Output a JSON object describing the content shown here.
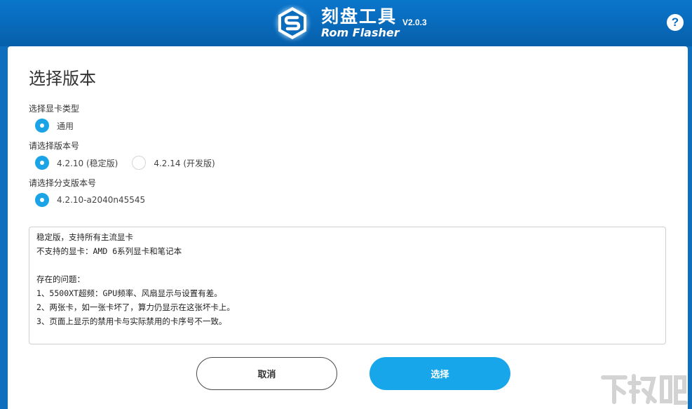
{
  "header": {
    "app_name_cn": "刻盘工具",
    "app_name_en": "Rom Flasher",
    "version": "V2.0.3",
    "help_glyph": "?",
    "brand_color": "#0a6cbd"
  },
  "page": {
    "title": "选择版本"
  },
  "gpu_type": {
    "label": "选择显卡类型",
    "options": [
      {
        "text": "通用",
        "selected": true
      }
    ]
  },
  "version_select": {
    "label": "请选择版本号",
    "options": [
      {
        "text": "4.2.10 (稳定版)",
        "selected": true
      },
      {
        "text": "4.2.14 (开发版)",
        "selected": false
      }
    ]
  },
  "branch_select": {
    "label": "请选择分支版本号",
    "options": [
      {
        "text": "4.2.10-a2040n45545",
        "selected": true
      }
    ]
  },
  "description": {
    "lines": [
      "稳定版，支持所有主流显卡",
      "不支持的显卡：AMD 6系列显卡和笔记本",
      "",
      "存在的问题：",
      "1、5500XT超频：GPU频率、风扇显示与设置有差。",
      "2、两张卡，如一张卡坏了，算力仍显示在这张坏卡上。",
      "3、页面上显示的禁用卡与实际禁用的卡序号不一致。"
    ]
  },
  "buttons": {
    "cancel_label": "取消",
    "select_label": "选择",
    "accent_color": "#17a6ea"
  },
  "icons": {
    "logo": "rom-flasher-logo-icon",
    "help": "help-icon",
    "watermark": "xiazaiba-watermark-icon"
  }
}
